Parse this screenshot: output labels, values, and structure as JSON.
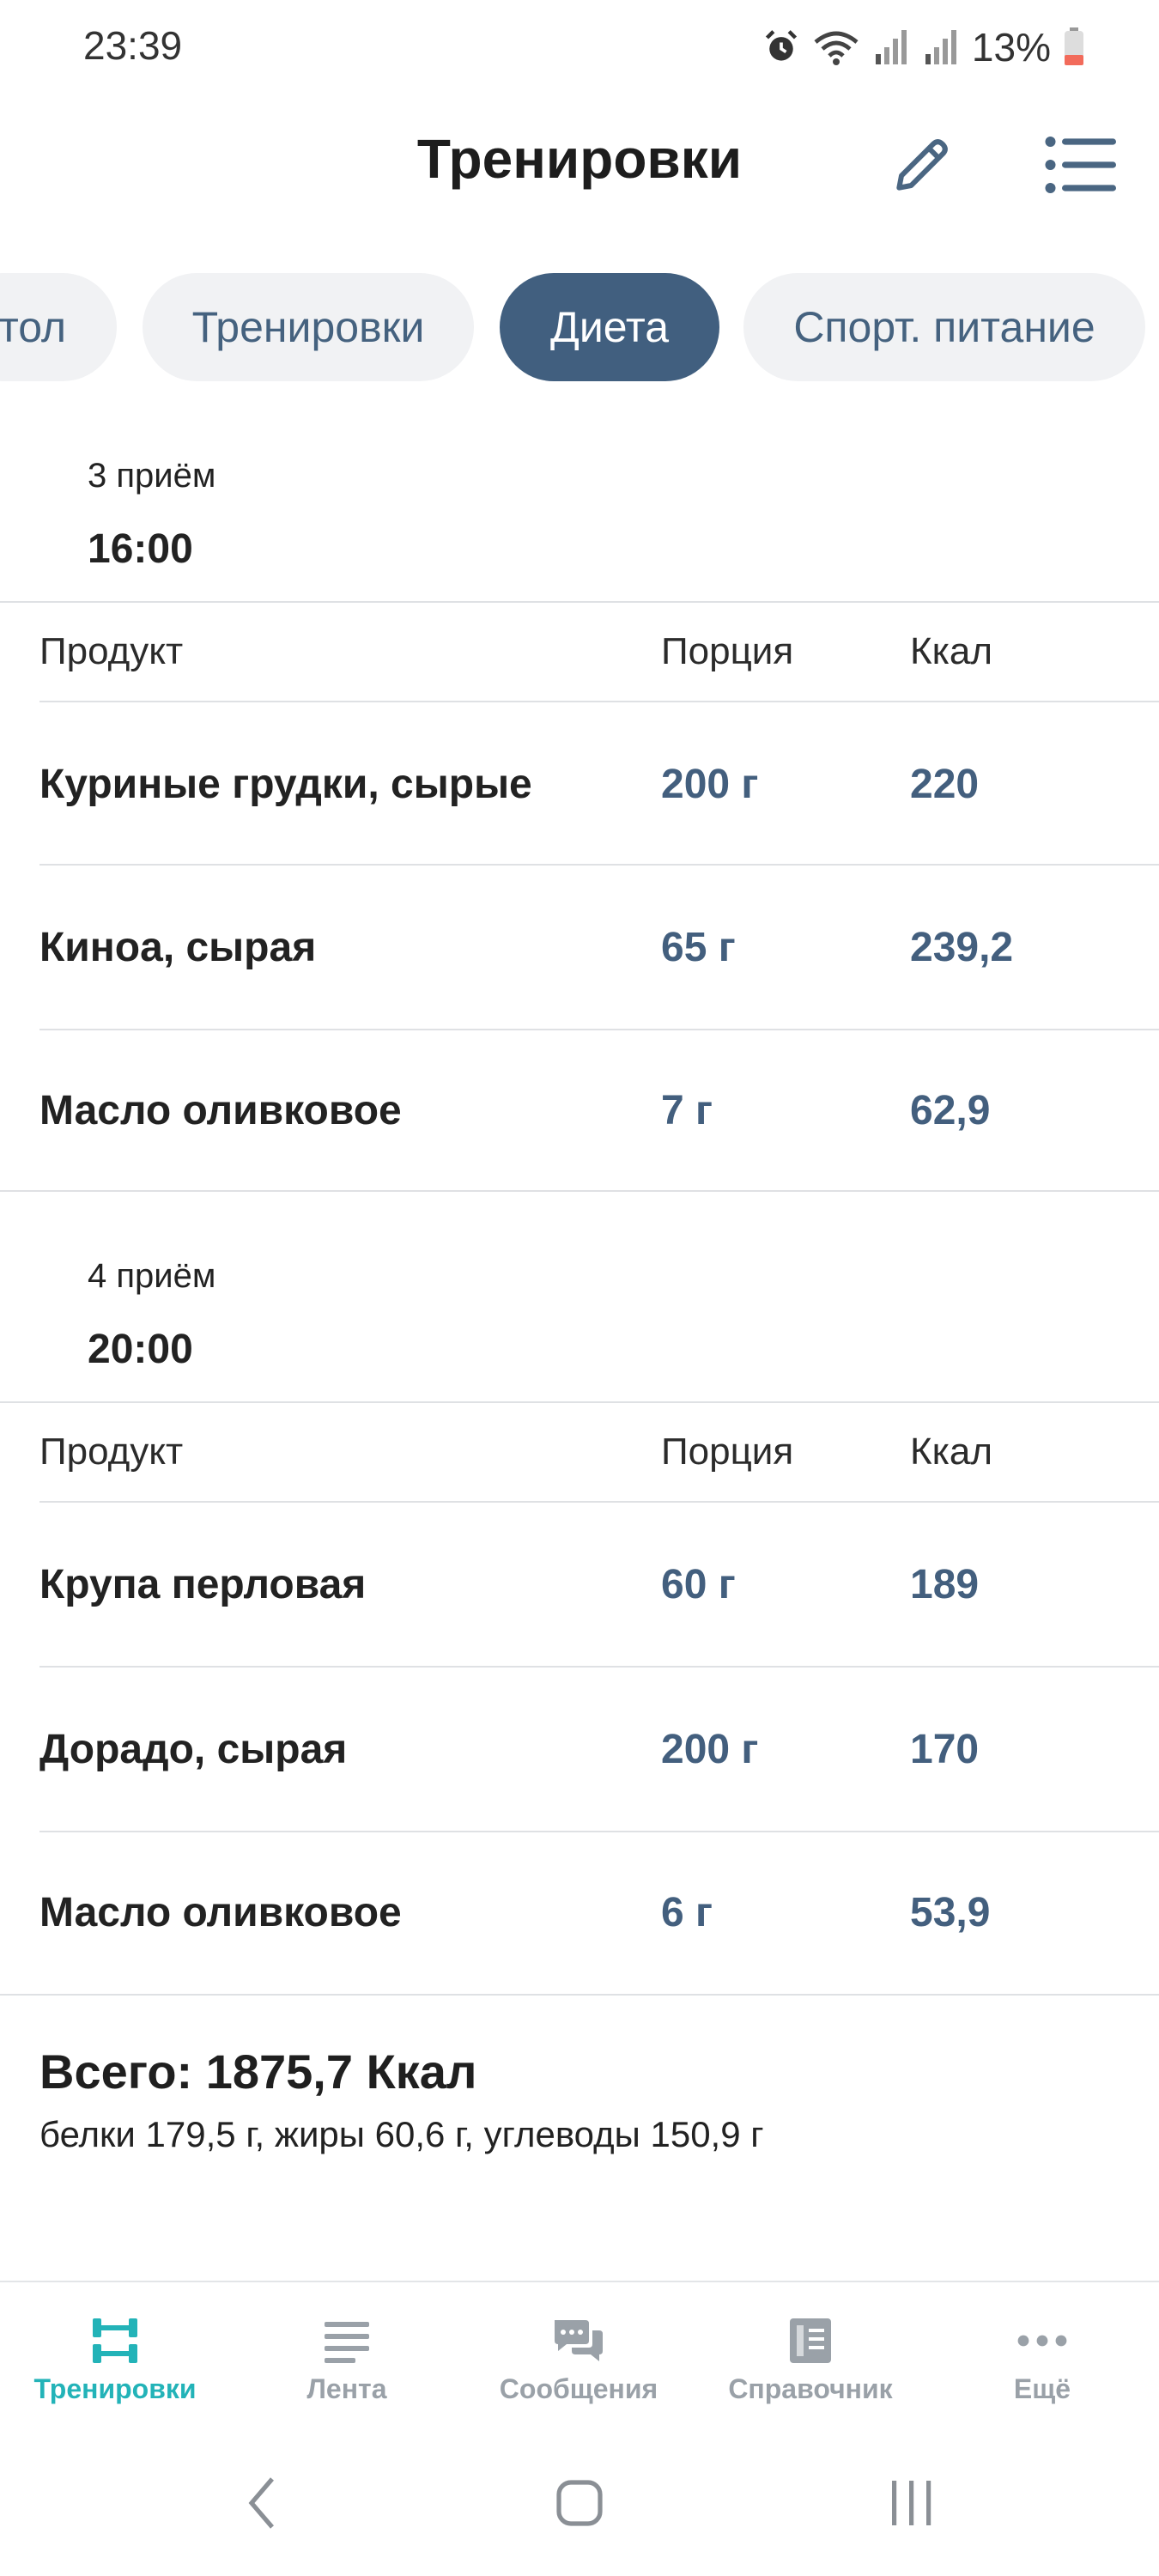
{
  "status_bar": {
    "time": "23:39",
    "battery": "13%"
  },
  "header": {
    "title": "Тренировки"
  },
  "chips": [
    {
      "label": "тол",
      "active": false
    },
    {
      "label": "Тренировки",
      "active": false
    },
    {
      "label": "Диета",
      "active": true
    },
    {
      "label": "Спорт. питание",
      "active": false
    }
  ],
  "meals": [
    {
      "number": "3 приём",
      "time": "16:00",
      "columns": {
        "product": "Продукт",
        "portion": "Порция",
        "kcal": "Ккал"
      },
      "rows": [
        {
          "product": "Куриные грудки, сырые",
          "portion": "200 г",
          "kcal": "220"
        },
        {
          "product": "Киноа, сырая",
          "portion": "65 г",
          "kcal": "239,2"
        },
        {
          "product": "Масло оливковое",
          "portion": "7 г",
          "kcal": "62,9"
        }
      ]
    },
    {
      "number": "4 приём",
      "time": "20:00",
      "columns": {
        "product": "Продукт",
        "portion": "Порция",
        "kcal": "Ккал"
      },
      "rows": [
        {
          "product": "Крупа перловая",
          "portion": "60 г",
          "kcal": "189"
        },
        {
          "product": "Дорадо, сырая",
          "portion": "200 г",
          "kcal": "170"
        },
        {
          "product": "Масло оливковое",
          "portion": "6 г",
          "kcal": "53,9"
        }
      ]
    }
  ],
  "summary": {
    "total": "Всего: 1875,7 Ккал",
    "macros": "белки 179,5 г, жиры 60,6 г, углеводы 150,9 г"
  },
  "bottom_nav": [
    {
      "label": "Тренировки",
      "icon": "dumbbell-icon",
      "active": true
    },
    {
      "label": "Лента",
      "icon": "feed-icon",
      "active": false
    },
    {
      "label": "Сообщения",
      "icon": "messages-icon",
      "active": false
    },
    {
      "label": "Справочник",
      "icon": "book-icon",
      "active": false
    },
    {
      "label": "Ещё",
      "icon": "more-icon",
      "active": false
    }
  ],
  "colors": {
    "accent": "#415f7f",
    "value": "#435f7e",
    "nav_active": "#23b3b8",
    "nav_inactive": "#9aa1a8"
  }
}
